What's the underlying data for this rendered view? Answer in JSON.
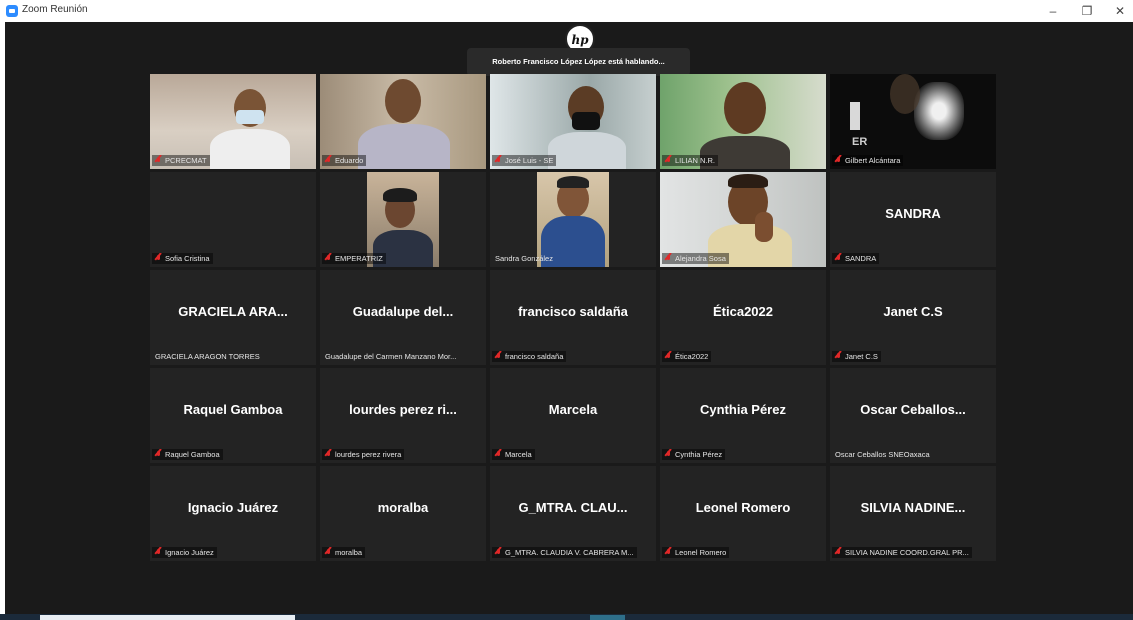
{
  "window": {
    "title": "Zoom Reunión",
    "minimize": "–",
    "maximize": "❐",
    "close": "✕"
  },
  "speaker_banner": "Roberto Francisco López López está hablando...",
  "hp_logo_text": "hp",
  "participants": [
    {
      "label": "PCRECMAT",
      "muted": true,
      "video": true
    },
    {
      "label": "Eduardo",
      "muted": true,
      "video": true
    },
    {
      "label": "José Luis - SE",
      "muted": true,
      "video": true
    },
    {
      "label": "LILIAN N.R.",
      "muted": true,
      "video": true
    },
    {
      "label": "Gilbert Alcántara",
      "muted": true,
      "video": true
    },
    {
      "label": "Sofia Cristina",
      "muted": true,
      "video": true
    },
    {
      "label": "EMPERATRIZ",
      "muted": true,
      "video": true
    },
    {
      "label": "Sandra González",
      "muted": false,
      "video": true
    },
    {
      "label": "Alejandra Sosa",
      "muted": true,
      "video": true
    },
    {
      "big": "SANDRA",
      "label": "SANDRA",
      "muted": true
    },
    {
      "big": "GRACIELA  ARA...",
      "label": "GRACIELA ARAGON TORRES",
      "muted": false
    },
    {
      "big": "Guadalupe  del...",
      "label": "Guadalupe del Carmen Manzano Mor...",
      "muted": false
    },
    {
      "big": "francisco saldaña",
      "label": "francisco saldaña",
      "muted": true
    },
    {
      "big": "Ética2022",
      "label": "Ética2022",
      "muted": true
    },
    {
      "big": "Janet C.S",
      "label": "Janet C.S",
      "muted": true
    },
    {
      "big": "Raquel Gamboa",
      "label": "Raquel Gamboa",
      "muted": true
    },
    {
      "big": "lourdes perez ri...",
      "label": "lourdes perez rivera",
      "muted": true
    },
    {
      "big": "Marcela",
      "label": "Marcela",
      "muted": true
    },
    {
      "big": "Cynthia Pérez",
      "label": "Cynthia Pérez",
      "muted": true
    },
    {
      "big": "Oscar  Ceballos...",
      "label": "Oscar Ceballos SNEOaxaca",
      "muted": false
    },
    {
      "big": "Ignacio Juárez",
      "label": "Ignacio Juárez",
      "muted": true
    },
    {
      "big": "moralba",
      "label": "moralba",
      "muted": true
    },
    {
      "big": "G_MTRA.  CLAU...",
      "label": "G_MTRA. CLAUDIA V. CABRERA M...",
      "muted": true
    },
    {
      "big": "Leonel Romero",
      "label": "Leonel Romero",
      "muted": true
    },
    {
      "big": "SILVIA  NADINE...",
      "label": "SILVIA NADINE COORD.GRAL PR...",
      "muted": true
    }
  ],
  "colors": {
    "meeting_bg": "#1a1a1a",
    "tile_bg": "#232323",
    "muted_red": "#e02828",
    "zoom_blue": "#2d8cff"
  }
}
